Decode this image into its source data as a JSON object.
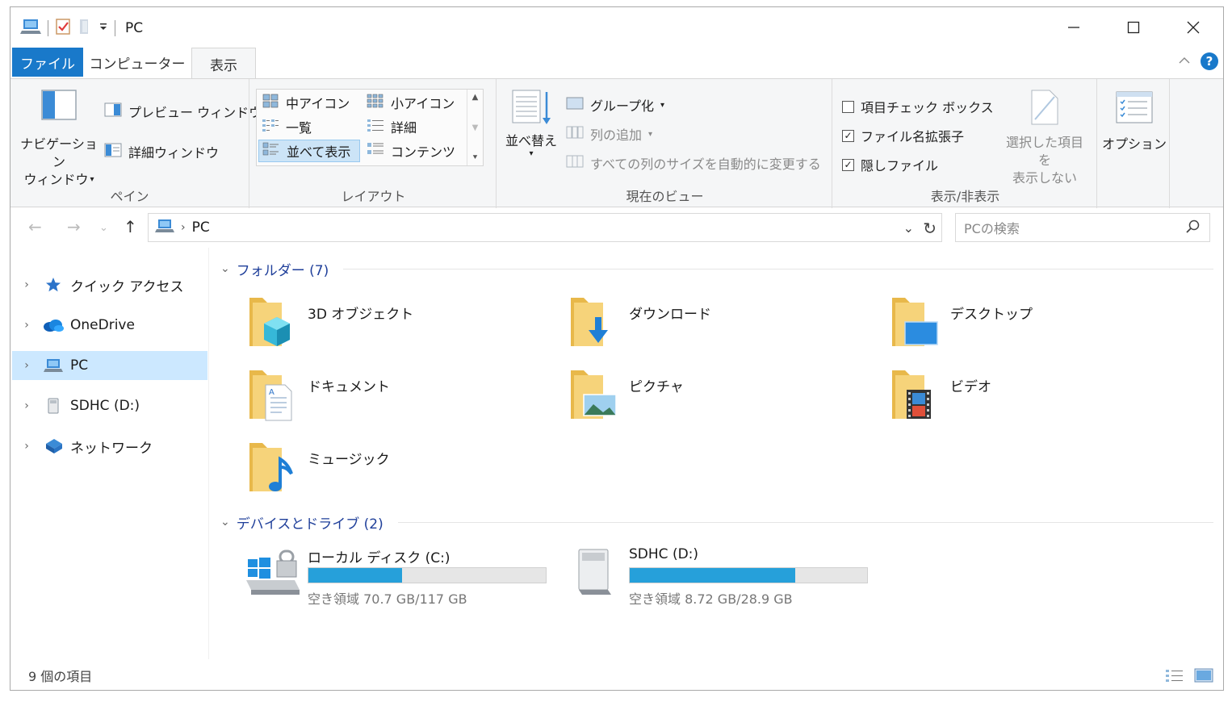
{
  "window": {
    "title": "PC",
    "controls": [
      "minimize",
      "maximize",
      "close"
    ]
  },
  "ribbon_tabs": [
    {
      "label": "ファイル",
      "active": false
    },
    {
      "label": "コンピューター",
      "active": false
    },
    {
      "label": "表示",
      "active": true
    }
  ],
  "ribbon": {
    "pane": {
      "group_label": "ペイン",
      "nav_pane_label_1": "ナビゲーション",
      "nav_pane_label_2": "ウィンドウ",
      "preview_pane": "プレビュー ウィンドウ",
      "details_pane": "詳細ウィンドウ"
    },
    "layout": {
      "group_label": "レイアウト",
      "items": [
        "中アイコン",
        "小アイコン",
        "一覧",
        "詳細",
        "並べて表示",
        "コンテンツ"
      ],
      "selected": "並べて表示"
    },
    "current_view": {
      "group_label": "現在のビュー",
      "sort": "並べ替え",
      "group_by": "グループ化",
      "add_columns": "列の追加",
      "size_columns": "すべての列のサイズを自動的に変更する"
    },
    "show_hide": {
      "group_label": "表示/非表示",
      "item_checkboxes": {
        "label": "項目チェック ボックス",
        "checked": false
      },
      "file_extensions": {
        "label": "ファイル名拡張子",
        "checked": true
      },
      "hidden_items": {
        "label": "隠しファイル",
        "checked": true
      },
      "hide_selected_1": "選択した項目を",
      "hide_selected_2": "表示しない"
    },
    "options": {
      "label": "オプション"
    }
  },
  "address": {
    "path": "PC",
    "search_placeholder": "PCの検索"
  },
  "nav_pane": [
    {
      "label": "クイック アクセス",
      "icon": "star-icon",
      "selected": false
    },
    {
      "label": "OneDrive",
      "icon": "cloud-icon",
      "selected": false
    },
    {
      "label": "PC",
      "icon": "computer-icon",
      "selected": true
    },
    {
      "label": "SDHC (D:)",
      "icon": "sd-drive-icon",
      "selected": false
    },
    {
      "label": "ネットワーク",
      "icon": "network-icon",
      "selected": false
    }
  ],
  "folders_section": {
    "title": "フォルダー (7)",
    "items": [
      {
        "name": "3D オブジェクト",
        "icon": "3d-objects-folder-icon"
      },
      {
        "name": "ダウンロード",
        "icon": "downloads-folder-icon"
      },
      {
        "name": "デスクトップ",
        "icon": "desktop-folder-icon"
      },
      {
        "name": "ドキュメント",
        "icon": "documents-folder-icon"
      },
      {
        "name": "ピクチャ",
        "icon": "pictures-folder-icon"
      },
      {
        "name": "ビデオ",
        "icon": "videos-folder-icon"
      },
      {
        "name": "ミュージック",
        "icon": "music-folder-icon"
      }
    ]
  },
  "drives_section": {
    "title": "デバイスとドライブ (2)",
    "items": [
      {
        "name": "ローカル ディスク (C:)",
        "free_text": "空き領域 70.7 GB/117 GB",
        "used_fraction": 0.396,
        "icon": "windows-drive-icon"
      },
      {
        "name": "SDHC (D:)",
        "free_text": "空き領域 8.72 GB/28.9 GB",
        "used_fraction": 0.698,
        "icon": "sd-drive-icon"
      }
    ]
  },
  "status_bar": {
    "item_count": "9 個の項目"
  },
  "colors": {
    "accent": "#1979ca",
    "drive_bar": "#26a0da",
    "selection": "#cce8ff",
    "section_header": "#1f3f9a"
  }
}
